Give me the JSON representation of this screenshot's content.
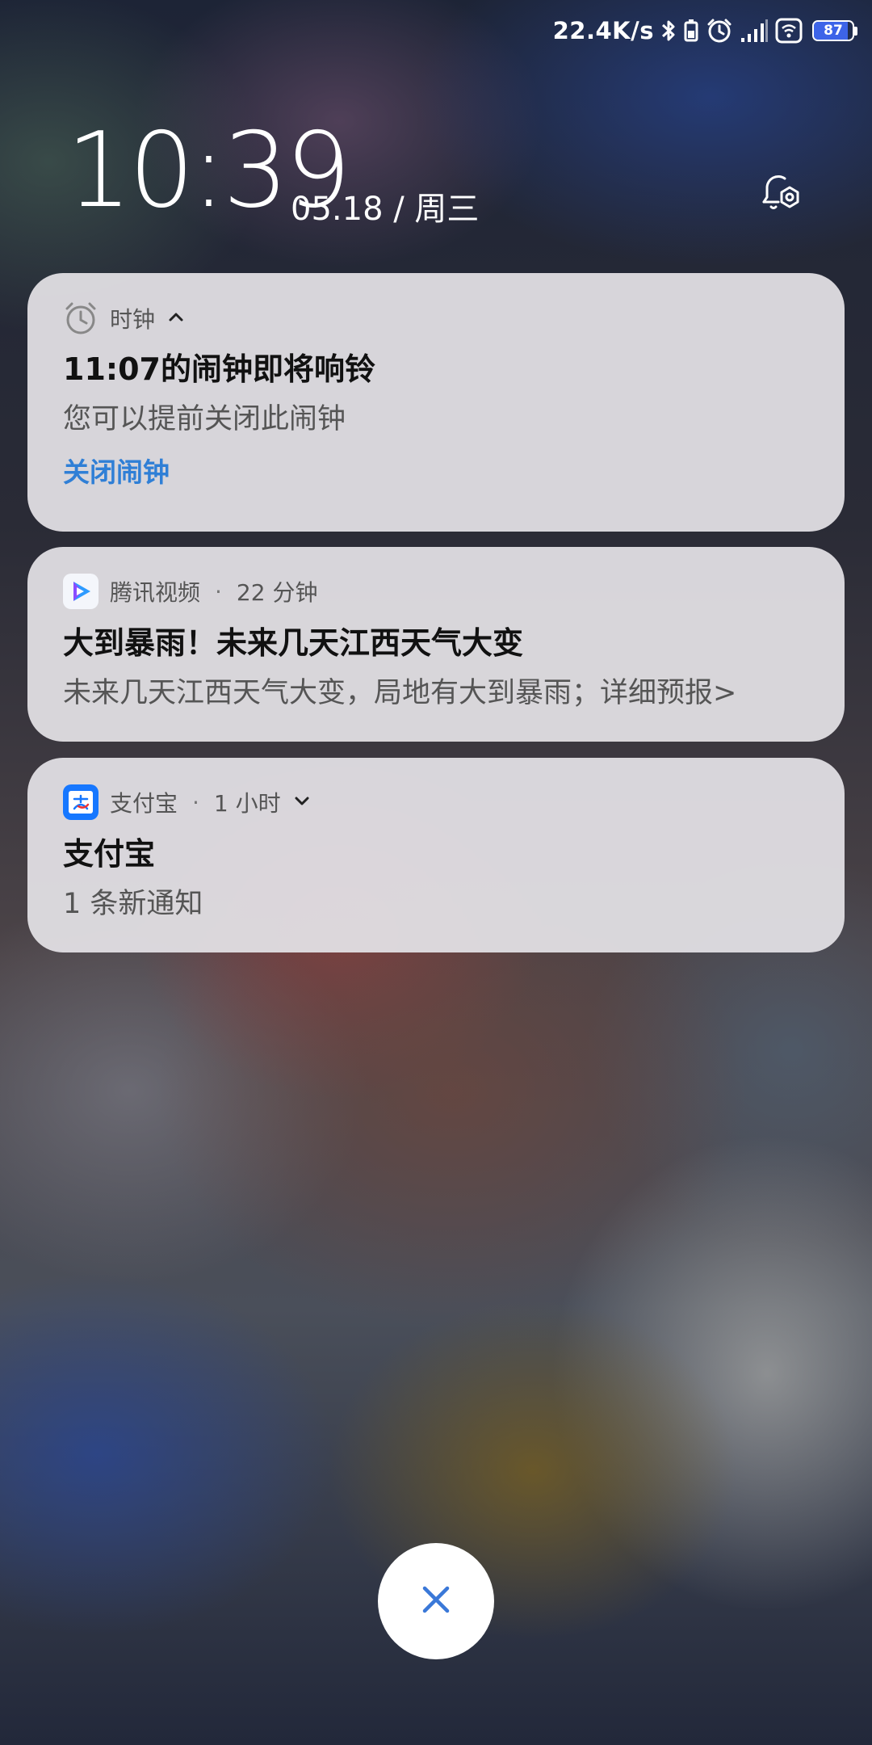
{
  "status_bar": {
    "net_speed": "22.4K/s",
    "battery_level": "87",
    "icons": [
      "bluetooth-icon",
      "battery-saver-icon",
      "alarm-icon",
      "signal-icon",
      "wifi-icon",
      "battery-icon"
    ]
  },
  "lockscreen": {
    "time": "10:39",
    "date": "05.18 / 周三",
    "settings_icon": "notification-settings-icon"
  },
  "notifications": [
    {
      "app": "时钟",
      "icon": "clock-app-icon",
      "expand_icon": "chevron-up-icon",
      "title": "11:07的闹钟即将响铃",
      "body": "您可以提前关闭此闹钟",
      "action": "关闭闹钟"
    },
    {
      "app": "腾讯视频",
      "icon": "tencent-video-icon",
      "time": "22 分钟",
      "title": "大到暴雨！未来几天江西天气大变",
      "body": "未来几天江西天气大变，局地有大到暴雨；详细预报>"
    },
    {
      "app": "支付宝",
      "icon": "alipay-icon",
      "time": "1 小时",
      "expand_icon": "chevron-down-icon",
      "title": "支付宝",
      "body": "1 条新通知"
    }
  ],
  "clear_button": {
    "icon": "close-icon"
  },
  "colors": {
    "accent": "#2f7fd6",
    "battery_fill": "#3d64e8"
  }
}
